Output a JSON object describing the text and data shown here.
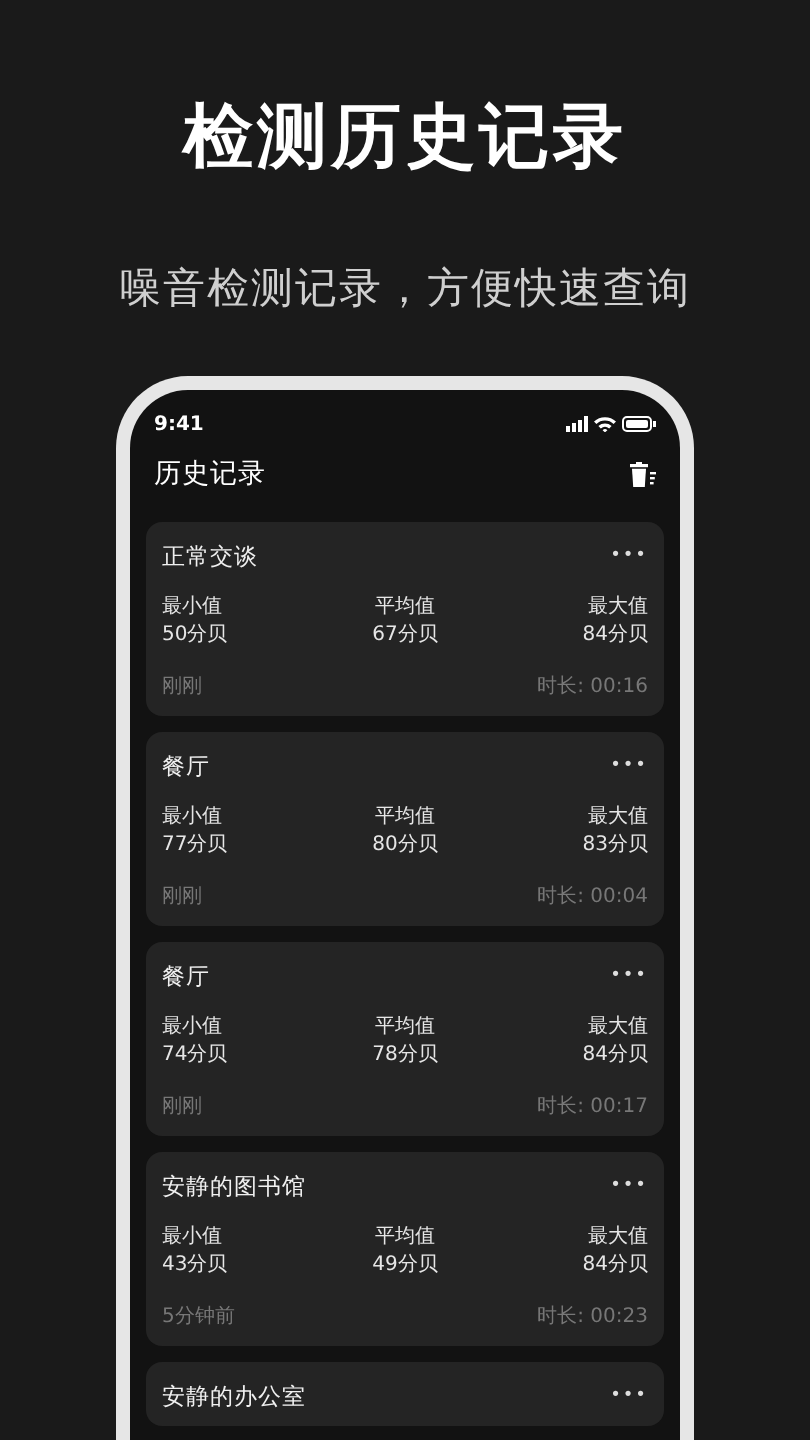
{
  "headline": "检测历史记录",
  "subtitle": "噪音检测记录，方便快速查询",
  "phone": {
    "status_bar": {
      "time": "9:41"
    },
    "title": "历史记录",
    "records": [
      {
        "title": "正常交谈",
        "more": "•••",
        "stats": [
          {
            "label": "最小值",
            "value": "50分贝"
          },
          {
            "label": "平均值",
            "value": "67分贝"
          },
          {
            "label": "最大值",
            "value": "84分贝"
          }
        ],
        "time": "刚刚",
        "duration": "时长: 00:16"
      },
      {
        "title": "餐厅",
        "more": "•••",
        "stats": [
          {
            "label": "最小值",
            "value": "77分贝"
          },
          {
            "label": "平均值",
            "value": "80分贝"
          },
          {
            "label": "最大值",
            "value": "83分贝"
          }
        ],
        "time": "刚刚",
        "duration": "时长: 00:04"
      },
      {
        "title": "餐厅",
        "more": "•••",
        "stats": [
          {
            "label": "最小值",
            "value": "74分贝"
          },
          {
            "label": "平均值",
            "value": "78分贝"
          },
          {
            "label": "最大值",
            "value": "84分贝"
          }
        ],
        "time": "刚刚",
        "duration": "时长: 00:17"
      },
      {
        "title": "安静的图书馆",
        "more": "•••",
        "stats": [
          {
            "label": "最小值",
            "value": "43分贝"
          },
          {
            "label": "平均值",
            "value": "49分贝"
          },
          {
            "label": "最大值",
            "value": "84分贝"
          }
        ],
        "time": "5分钟前",
        "duration": "时长: 00:23"
      },
      {
        "title": "安静的办公室",
        "more": "•••"
      }
    ]
  }
}
